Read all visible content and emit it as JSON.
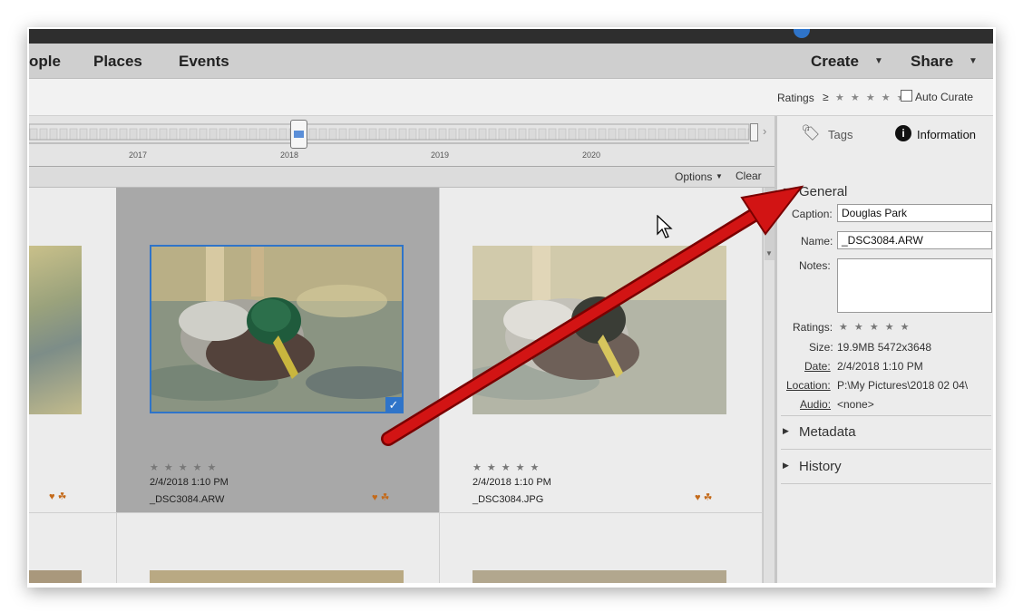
{
  "nav": {
    "people": "ople",
    "places": "Places",
    "events": "Events",
    "create": "Create",
    "share": "Share"
  },
  "ratings_bar": {
    "label": "Ratings",
    "operator": "≥",
    "stars": "★ ★ ★ ★ ★",
    "auto_curate": "Auto Curate"
  },
  "timeline": {
    "years": [
      "2017",
      "2018",
      "2019",
      "2020"
    ]
  },
  "options_bar": {
    "options": "Options",
    "clear": "Clear"
  },
  "media": [
    {
      "stars": "★★★★★",
      "date": "",
      "name": ""
    },
    {
      "stars": "★★★★★",
      "date": "2/4/2018 1:10 PM",
      "name": "_DSC3084.ARW"
    },
    {
      "stars": "★★★★★",
      "date": "2/4/2018 1:10 PM",
      "name": "_DSC3084.JPG"
    }
  ],
  "panel": {
    "tab_tags": "Tags",
    "tab_information": "Information",
    "general": "General",
    "caption_label": "Caption:",
    "caption_value": "Douglas Park",
    "name_label": "Name:",
    "name_value": "_DSC3084.ARW",
    "notes_label": "Notes:",
    "notes_value": "",
    "ratings_label": "Ratings:",
    "ratings_stars": "★ ★ ★ ★ ★",
    "size_label": "Size:",
    "size_value": "19.9MB  5472x3648",
    "date_label": "Date:",
    "date_value": "2/4/2018 1:10 PM",
    "location_label": "Location:",
    "location_value": "P:\\My Pictures\\2018 02 04\\",
    "audio_label": "Audio:",
    "audio_value": "<none>",
    "metadata": "Metadata",
    "history": "History"
  },
  "colors": {
    "accent_blue": "#2f74c9",
    "arrow_red": "#d21414",
    "selected_cell": "#a8a8a8"
  }
}
